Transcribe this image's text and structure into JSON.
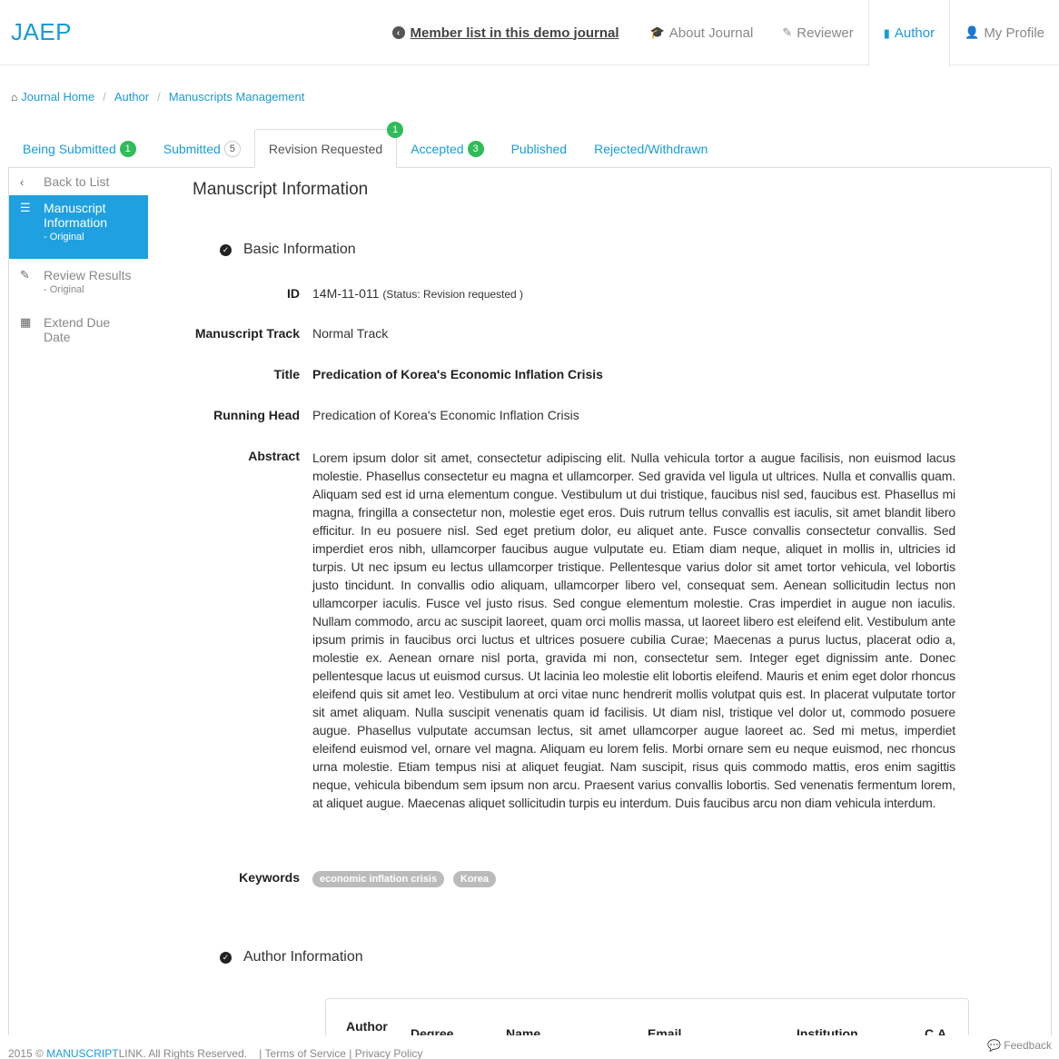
{
  "brand": "JAEP",
  "nav": {
    "member_link": "Member list in this demo journal",
    "about": "About Journal",
    "reviewer": "Reviewer",
    "author": "Author",
    "profile": "My Profile"
  },
  "breadcrumb": [
    "Journal Home",
    "Author",
    "Manuscripts Management"
  ],
  "tabs": [
    {
      "label": "Being Submitted",
      "badge": "1"
    },
    {
      "label": "Submitted",
      "badge": "5"
    },
    {
      "label": "Revision Requested",
      "badge": "1"
    },
    {
      "label": "Accepted",
      "badge": "3"
    },
    {
      "label": "Published",
      "badge": ""
    },
    {
      "label": "Rejected/Withdrawn",
      "badge": ""
    }
  ],
  "sidebar": {
    "back": "Back to List",
    "manuscript_info": "Manuscript Information",
    "manuscript_info_sub": "- Original",
    "review_results": "Review Results",
    "review_results_sub": "- Original",
    "extend": "Extend Due Date"
  },
  "main": {
    "title": "Manuscript Information",
    "basic_section": "Basic Information",
    "author_section": "Author Information",
    "fields": {
      "id_label": "ID",
      "id_value": "14M-11-011",
      "id_status": "(Status: Revision requested )",
      "track_label": "Manuscript Track",
      "track_value": "Normal Track",
      "title_label": "Title",
      "title_value": "Predication of Korea's Economic Inflation Crisis",
      "running_label": "Running Head",
      "running_value": "Predication of Korea's Economic Inflation Crisis",
      "abstract_label": "Abstract",
      "abstract_value": "Lorem ipsum dolor sit amet, consectetur adipiscing elit. Nulla vehicula tortor a augue facilisis, non euismod lacus molestie. Phasellus consectetur eu magna et ullamcorper. Sed gravida vel ligula ut ultrices. Nulla et convallis quam. Aliquam sed est id urna elementum congue. Vestibulum ut dui tristique, faucibus nisl sed, faucibus est. Phasellus mi magna, fringilla a consectetur non, molestie eget eros. Duis rutrum tellus convallis est iaculis, sit amet blandit libero efficitur. In eu posuere nisl. Sed eget pretium dolor, eu aliquet ante. Fusce convallis consectetur convallis. Sed imperdiet eros nibh, ullamcorper faucibus augue vulputate eu. Etiam diam neque, aliquet in mollis in, ultricies id turpis. Ut nec ipsum eu lectus ullamcorper tristique. Pellentesque varius dolor sit amet tortor vehicula, vel lobortis justo tincidunt. In convallis odio aliquam, ullamcorper libero vel, consequat sem. Aenean sollicitudin lectus non ullamcorper iaculis. Fusce vel justo risus. Sed congue elementum molestie. Cras imperdiet in augue non iaculis. Nullam commodo, arcu ac suscipit laoreet, quam orci mollis massa, ut laoreet libero est eleifend elit. Vestibulum ante ipsum primis in faucibus orci luctus et ultrices posuere cubilia Curae; Maecenas a purus luctus, placerat odio a, molestie ex. Aenean ornare nisl porta, gravida mi non, consectetur sem. Integer eget dignissim ante. Donec pellentesque lacus ut euismod cursus. Ut lacinia leo molestie elit lobortis eleifend. Mauris et enim eget dolor rhoncus eleifend quis sit amet leo. Vestibulum at orci vitae nunc hendrerit mollis volutpat quis est. In placerat vulputate tortor sit amet aliquam. Nulla suscipit venenatis quam id facilisis. Ut diam nisl, tristique vel dolor ut, commodo posuere augue. Phasellus vulputate accumsan lectus, sit amet ullamcorper augue laoreet ac. Sed mi metus, imperdiet eleifend euismod vel, ornare vel magna. Aliquam eu lorem felis. Morbi ornare sem eu neque euismod, nec rhoncus urna molestie. Etiam tempus nisi at aliquet feugiat. Nam suscipit, risus quis commodo mattis, eros enim sagittis neque, vehicula bibendum sem ipsum non arcu. Praesent varius convallis lobortis. Sed venenatis fermentum lorem, at aliquet augue. Maecenas aliquet sollicitudin turpis eu interdum. Duis faucibus arcu non diam vehicula interdum.",
      "keywords_label": "Keywords",
      "keywords": [
        "economic inflation crisis",
        "Korea"
      ]
    },
    "author_table_headers": [
      "Author",
      "Degree",
      "Name",
      "Email",
      "Institution",
      "C.A."
    ]
  },
  "footer": {
    "year": "2015 ©",
    "brand_a": "MANUSCRIPT",
    "brand_b": "LINK",
    "rights": ". All Rights Reserved.",
    "terms": "Terms of Service",
    "privacy": "Privacy Policy",
    "feedback": "Feedback"
  },
  "colors": {
    "accent": "#1a9bd7",
    "badge_green": "#2ebd59",
    "sidebar_active": "#1fa0e0"
  },
  "icons": [
    "arrow-circle-left-icon",
    "graduation-cap-icon",
    "pencil-square-icon",
    "book-icon",
    "user-icon",
    "home-icon",
    "chevron-left-icon",
    "list-icon",
    "edit-icon",
    "calendar-icon",
    "check-circle-icon",
    "comments-icon"
  ]
}
